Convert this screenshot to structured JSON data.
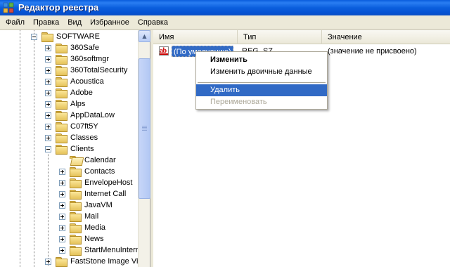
{
  "window": {
    "title": "Редактор реестра",
    "app_icon": "registry-editor-icon"
  },
  "menubar": {
    "items": [
      "Файл",
      "Правка",
      "Вид",
      "Избранное",
      "Справка"
    ]
  },
  "tree": {
    "root": "SOFTWARE",
    "items": [
      {
        "label": "360Safe",
        "expander": "plus"
      },
      {
        "label": "360softmgr",
        "expander": "plus"
      },
      {
        "label": "360TotalSecurity",
        "expander": "plus"
      },
      {
        "label": "Acoustica",
        "expander": "plus"
      },
      {
        "label": "Adobe",
        "expander": "plus"
      },
      {
        "label": "Alps",
        "expander": "plus"
      },
      {
        "label": "AppDataLow",
        "expander": "plus"
      },
      {
        "label": "C07ft5Y",
        "expander": "plus"
      },
      {
        "label": "Classes",
        "expander": "plus"
      },
      {
        "label": "Clients",
        "expander": "minus"
      }
    ],
    "clients_children": [
      {
        "label": "Calendar",
        "expander": "none",
        "open": true
      },
      {
        "label": "Contacts",
        "expander": "plus"
      },
      {
        "label": "EnvelopeHost",
        "expander": "plus"
      },
      {
        "label": "Internet Call",
        "expander": "plus"
      },
      {
        "label": "JavaVM",
        "expander": "plus"
      },
      {
        "label": "Mail",
        "expander": "plus"
      },
      {
        "label": "Media",
        "expander": "plus"
      },
      {
        "label": "News",
        "expander": "plus"
      },
      {
        "label": "StartMenuIntern",
        "expander": "plus"
      }
    ],
    "after": {
      "label": "FastStone Image Vie",
      "expander": "plus"
    }
  },
  "list": {
    "columns": [
      "Имя",
      "Тип",
      "Значение"
    ],
    "rows": [
      {
        "icon": "reg-sz-icon",
        "name": "(По умолчанию)",
        "type": "REG_SZ",
        "value": "(значение не присвоено)"
      }
    ]
  },
  "context_menu": {
    "items": [
      {
        "label": "Изменить",
        "state": "default-bold"
      },
      {
        "label": "Изменить двоичные данные",
        "state": "normal"
      },
      {
        "label": "Удалить",
        "state": "highlighted"
      },
      {
        "label": "Переименовать",
        "state": "disabled"
      }
    ]
  },
  "colors": {
    "selection": "#316ac5",
    "titlebar": "#0a5ddc",
    "disabled_text": "#aca899"
  }
}
